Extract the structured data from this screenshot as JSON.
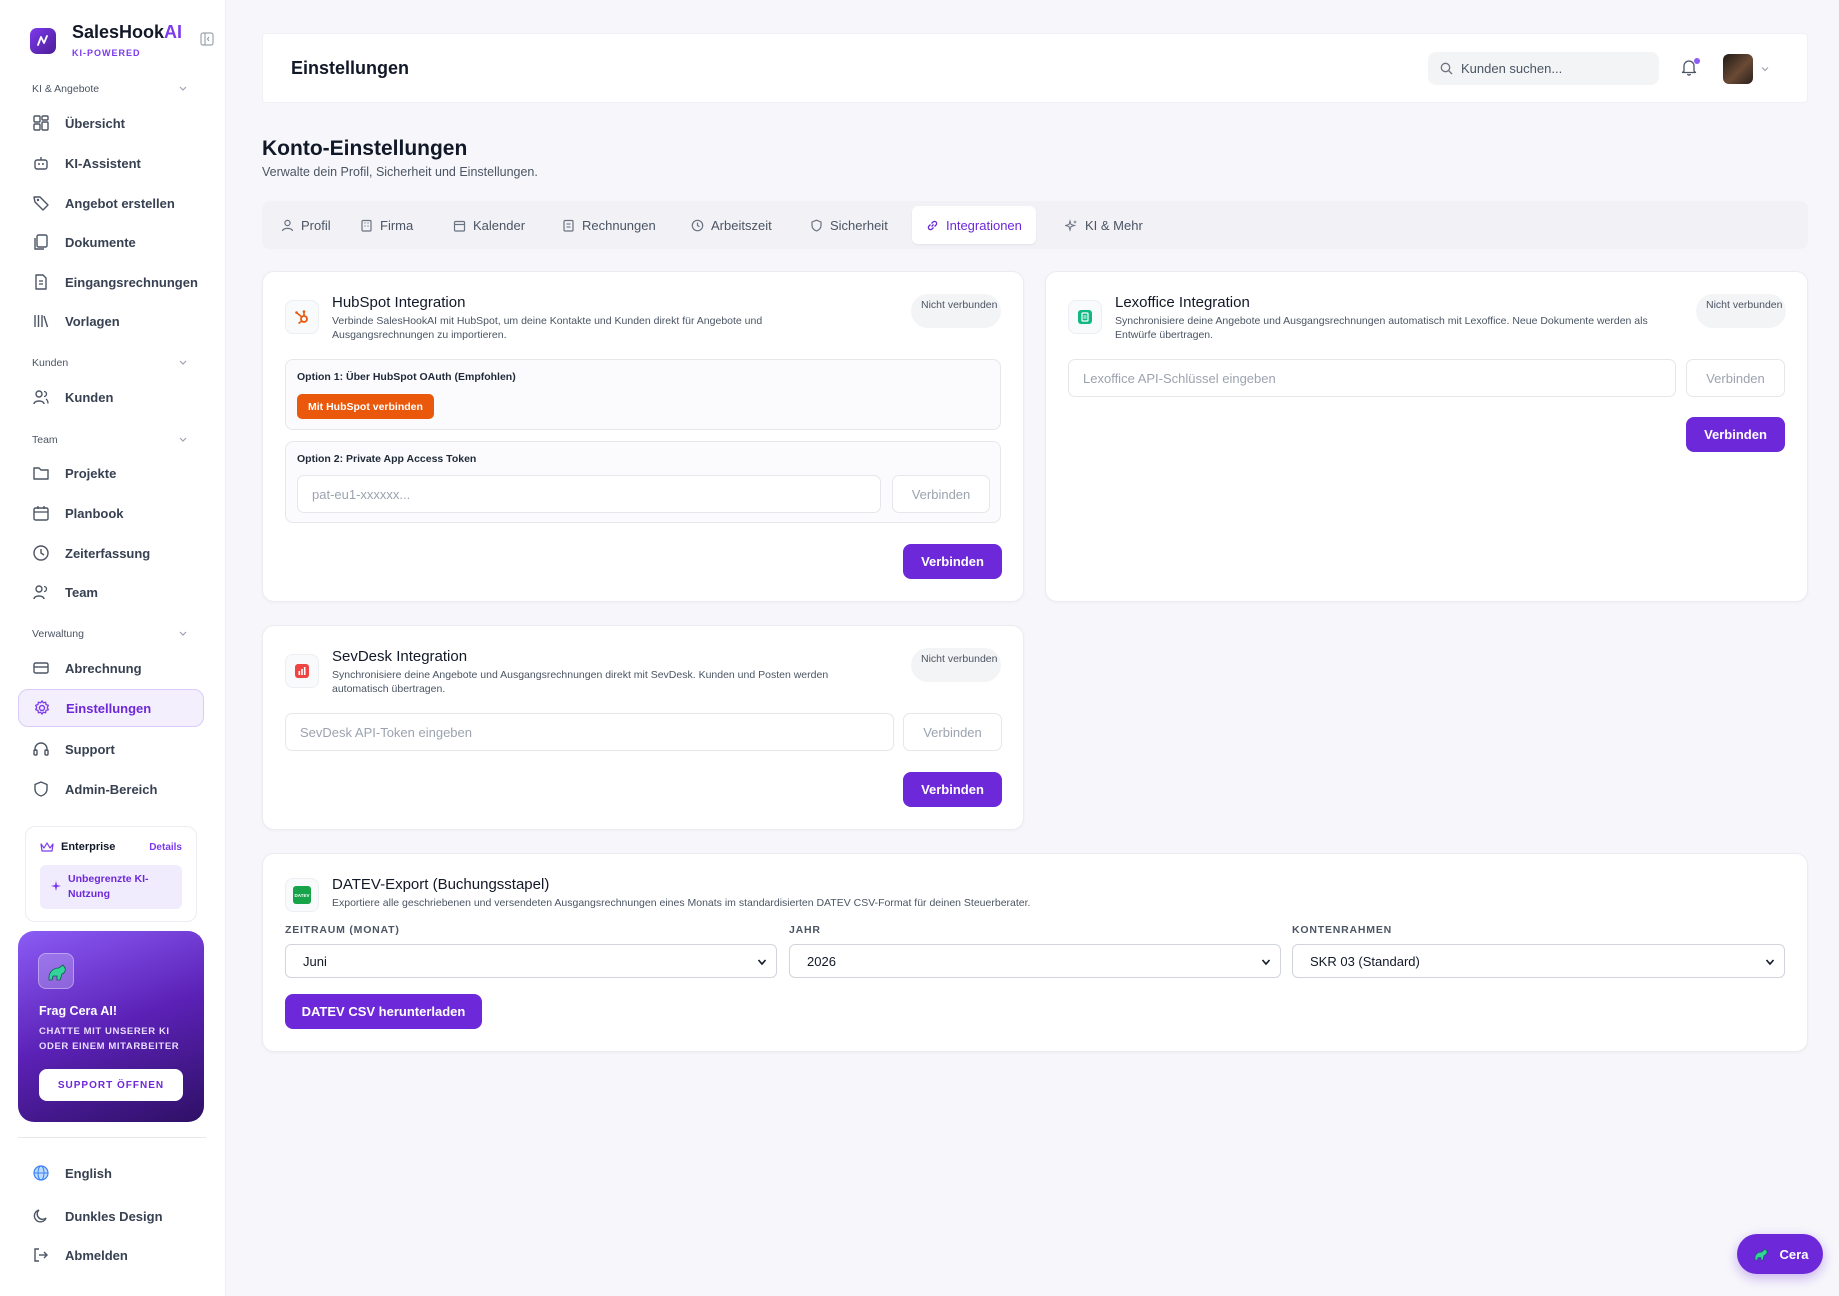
{
  "brand": {
    "name_main": "SalesHook",
    "name_ai": "AI",
    "tagline": "KI-POWERED"
  },
  "sidebar": {
    "sections": [
      {
        "title": "KI & Angebote"
      },
      {
        "title": "Kunden"
      },
      {
        "title": "Team"
      },
      {
        "title": "Verwaltung"
      }
    ],
    "items": [
      {
        "label": "Übersicht",
        "icon": "dashboard-icon"
      },
      {
        "label": "KI-Assistent",
        "icon": "robot-icon"
      },
      {
        "label": "Angebot erstellen",
        "icon": "tag-icon"
      },
      {
        "label": "Dokumente",
        "icon": "documents-icon"
      },
      {
        "label": "Eingangsrechnungen",
        "icon": "receipt-icon"
      },
      {
        "label": "Vorlagen",
        "icon": "library-icon"
      },
      {
        "label": "Kunden",
        "icon": "users-icon"
      },
      {
        "label": "Projekte",
        "icon": "folder-icon"
      },
      {
        "label": "Planbook",
        "icon": "calendar-icon"
      },
      {
        "label": "Zeiterfassung",
        "icon": "clock-icon"
      },
      {
        "label": "Team",
        "icon": "team-icon"
      },
      {
        "label": "Abrechnung",
        "icon": "credit-card-icon"
      },
      {
        "label": "Einstellungen",
        "icon": "gear-icon",
        "active": true
      },
      {
        "label": "Support",
        "icon": "headset-icon"
      },
      {
        "label": "Admin-Bereich",
        "icon": "shield-icon"
      }
    ],
    "plan": {
      "name": "Enterprise",
      "details_link": "Details",
      "badge": "Unbegrenzte KI-Nutzung"
    },
    "cera_card": {
      "title": "Frag Cera AI!",
      "subtitle": "CHATTE MIT UNSERER KI ODER EINEM MITARBEITER",
      "button": "SUPPORT ÖFFNEN"
    },
    "footer": [
      {
        "label": "English",
        "icon": "globe-icon"
      },
      {
        "label": "Dunkles Design",
        "icon": "moon-icon"
      },
      {
        "label": "Abmelden",
        "icon": "logout-icon"
      }
    ]
  },
  "topbar": {
    "title": "Einstellungen",
    "search_placeholder": "Kunden suchen..."
  },
  "page": {
    "title": "Konto-Einstellungen",
    "subtitle": "Verwalte dein Profil, Sicherheit und Einstellungen."
  },
  "tabs": [
    {
      "label": "Profil",
      "icon": "user-icon"
    },
    {
      "label": "Firma",
      "icon": "building-icon"
    },
    {
      "label": "Kalender",
      "icon": "calendar-icon"
    },
    {
      "label": "Rechnungen",
      "icon": "invoice-icon"
    },
    {
      "label": "Arbeitszeit",
      "icon": "clock-icon"
    },
    {
      "label": "Sicherheit",
      "icon": "shield-icon"
    },
    {
      "label": "Integrationen",
      "icon": "link-icon",
      "active": true
    },
    {
      "label": "KI & Mehr",
      "icon": "sparkles-icon"
    }
  ],
  "hubspot": {
    "title": "HubSpot Integration",
    "description": "Verbinde SalesHookAI mit HubSpot, um deine Kontakte und Kunden direkt für Angebote und Ausgangsrechnungen zu importieren.",
    "status": "Nicht verbunden",
    "option1_label": "Option 1: Über HubSpot OAuth (Empfohlen)",
    "oauth_button": "Mit HubSpot verbinden",
    "option2_label": "Option 2: Private App Access Token",
    "token_placeholder": "pat-eu1-xxxxxx...",
    "inline_button": "Verbinden",
    "primary_button": "Verbinden"
  },
  "lexoffice": {
    "title": "Lexoffice Integration",
    "description": "Synchronisiere deine Angebote und Ausgangsrechnungen automatisch mit Lexoffice. Neue Dokumente werden als Entwürfe übertragen.",
    "status": "Nicht verbunden",
    "key_placeholder": "Lexoffice API-Schlüssel eingeben",
    "inline_button": "Verbinden",
    "primary_button": "Verbinden"
  },
  "sevdesk": {
    "title": "SevDesk Integration",
    "description": "Synchronisiere deine Angebote und Ausgangsrechnungen direkt mit SevDesk. Kunden und Posten werden automatisch übertragen.",
    "status": "Nicht verbunden",
    "token_placeholder": "SevDesk API-Token eingeben",
    "inline_button": "Verbinden",
    "primary_button": "Verbinden"
  },
  "datev": {
    "title": "DATEV-Export (Buchungsstapel)",
    "description": "Exportiere alle geschriebenen und versendeten Ausgangsrechnungen eines Monats im standardisierten DATEV CSV-Format für deinen Steuerberater.",
    "icon_text": "DATEV",
    "month_label": "ZEITRAUM (MONAT)",
    "month_value": "Juni",
    "year_label": "JAHR",
    "year_value": "2026",
    "chart_label": "KONTENRAHMEN",
    "chart_value": "SKR 03 (Standard)",
    "download_button": "DATEV CSV herunterladen"
  },
  "fab": {
    "label": "Cera"
  },
  "colors": {
    "accent": "#6d28d9",
    "hubspot": "#ea580c",
    "lexoffice": "#10b981",
    "sevdesk": "#ef4444",
    "datev": "#16a34a"
  }
}
